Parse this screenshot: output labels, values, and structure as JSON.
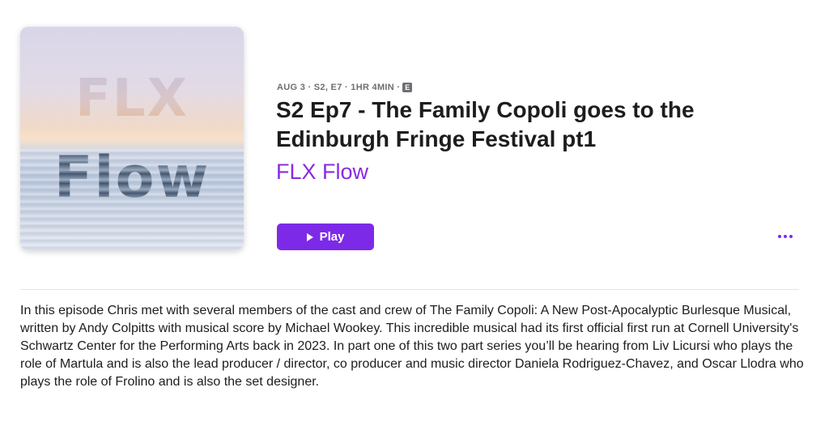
{
  "artwork": {
    "line1": "FLX",
    "line2": "Flow"
  },
  "episode": {
    "meta": "AUG 3 · S2, E7 · 1HR 4MIN ·",
    "explicit_badge": "E",
    "title": "S2 Ep7 - The Family Copoli goes to the Edinburgh Fringe Festival pt1",
    "show_name": "FLX Flow"
  },
  "actions": {
    "play_label": "Play",
    "more_icon": "ellipsis-icon"
  },
  "description": "In this episode Chris met with several members of the cast and crew of The Family Copoli: A New Post-Apocalyptic Burlesque Musical, written by Andy Colpitts with musical score by Michael Wookey.  This incredible musical had its first official first run at Cornell University's Schwartz Center for the Performing Arts back in 2023. In part one of this two part series you’ll be hearing from Liv Licursi who plays the role of Martula and is also the lead producer / director, co producer and music director Daniela Rodriguez-Chavez, and Oscar Llodra who plays the role of Frolino and is also the set designer.",
  "colors": {
    "accent": "#7d2ae8",
    "show_name": "#8a2be2",
    "meta_text": "#6e6e73"
  }
}
